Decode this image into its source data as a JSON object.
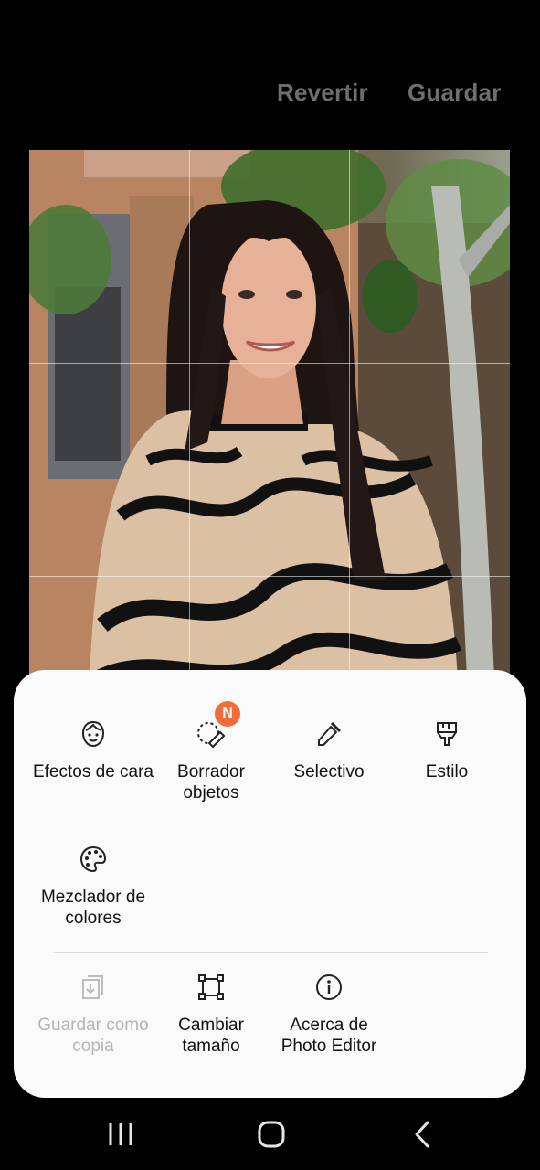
{
  "header": {
    "revert_label": "Revertir",
    "save_label": "Guardar"
  },
  "tools": {
    "face_effects": "Efectos de cara",
    "object_eraser": "Borrador objetos",
    "object_eraser_badge": "N",
    "selective": "Selectivo",
    "style": "Estilo",
    "color_mixer": "Mezclador de colores",
    "save_as_copy": "Guardar como copia",
    "resize": "Cambiar tamaño",
    "about": "Acerca de Photo Editor"
  },
  "colors": {
    "badge": "#f26b3a",
    "disabled_text": "#b5b5b5",
    "sheet_bg": "#fafafa"
  }
}
